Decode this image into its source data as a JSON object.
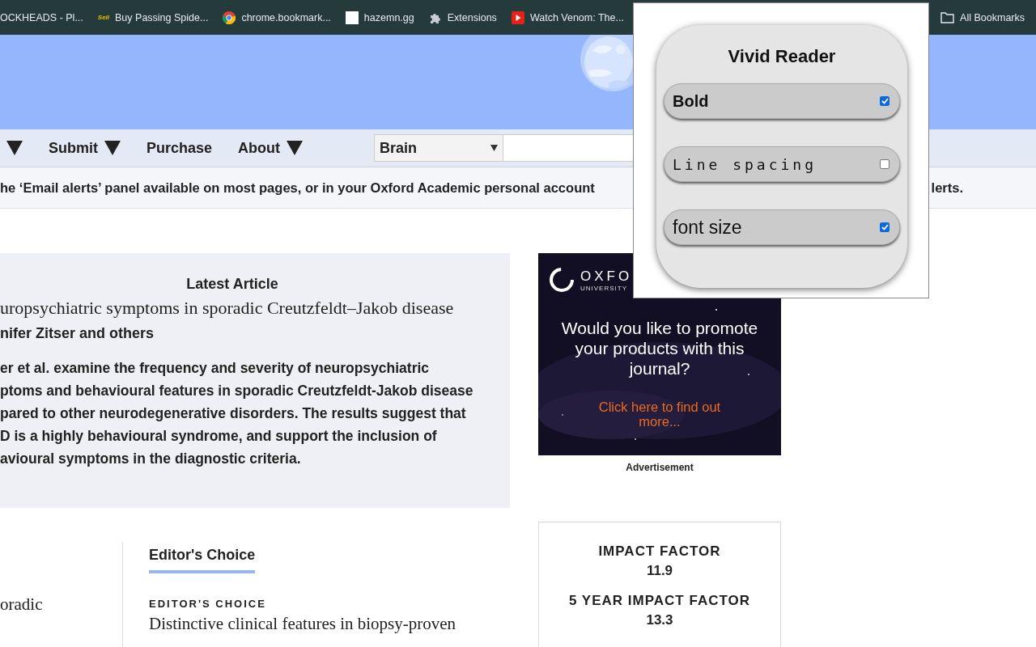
{
  "bookmarks": [
    {
      "kind": "none",
      "label": "OCKHEADS - Pl..."
    },
    {
      "kind": "sell",
      "label": "Buy Passing Spide...",
      "badge": "Sell"
    },
    {
      "kind": "chrome",
      "label": "chrome.bookmark..."
    },
    {
      "kind": "page",
      "label": "hazemn.gg"
    },
    {
      "kind": "puzzle",
      "label": "Extensions"
    },
    {
      "kind": "video",
      "label": "Watch Venom: The..."
    }
  ],
  "all_bookmarks": "All Bookmarks",
  "nav": {
    "items": [
      {
        "has_menu": true
      },
      {
        "label": "Submit",
        "has_menu": true
      },
      {
        "label": "Purchase",
        "has_menu": false
      },
      {
        "label": "About",
        "has_menu": true
      }
    ],
    "search_scope": "Brain"
  },
  "alert": {
    "text": "he ‘Email alerts’ panel available on most pages, or in your Oxford Academic personal account",
    "text_end": "lerts."
  },
  "latest": {
    "heading": "Latest Article",
    "title": "uropsychiatric symptoms in sporadic Creutzfeldt–Jakob disease",
    "authors": "nifer Zitser and others",
    "lines": [
      "er et al. examine the frequency and severity of neuropsychiatric",
      "ptoms and behavioural features in sporadic Creutzfeldt-Jakob disease",
      "pared to other neurodegenerative disorders. The results suggest that",
      "D is a highly behavioural syndrome, and support the inclusion of",
      "avioural symptoms in the diagnostic criteria."
    ]
  },
  "ad": {
    "brand": "OXFO",
    "brand_sub": "UNIVERSITY",
    "headline": "Would you like to promote your products with this journal?",
    "link": "Click here to find out more...",
    "label": "Advertisement"
  },
  "left_snippet": "oradic",
  "editors": {
    "tab": "Editor's Choice",
    "kicker": "EDITOR'S CHOICE",
    "title": "Distinctive clinical features in biopsy-proven"
  },
  "metrics": [
    {
      "name": "IMPACT FACTOR",
      "value": "11.9"
    },
    {
      "name": "5 YEAR IMPACT FACTOR",
      "value": "13.3"
    }
  ],
  "popup": {
    "title": "Vivid Reader",
    "options": [
      {
        "kind": "bold",
        "label": "Bold",
        "checked": true
      },
      {
        "kind": "spaced",
        "label": "Line spacing",
        "checked": false
      },
      {
        "kind": "large",
        "label": "font size",
        "checked": true
      }
    ]
  }
}
